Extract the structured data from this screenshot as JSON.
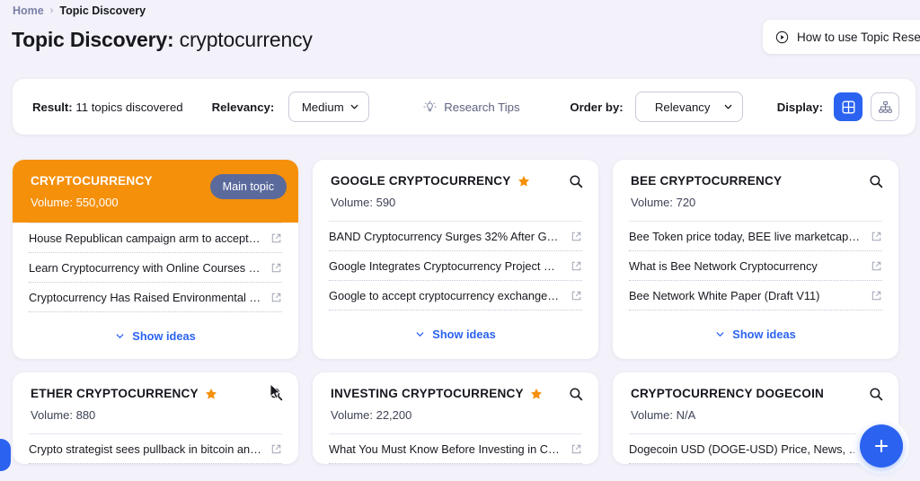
{
  "breadcrumb": {
    "home": "Home",
    "separator": "›",
    "current": "Topic Discovery"
  },
  "header": {
    "title_strong": "Topic Discovery:",
    "title_term": "cryptocurrency",
    "howto_label": "How to use Topic Research",
    "howto_icon": "play-circle-icon"
  },
  "toolbar": {
    "result_label": "Result:",
    "result_value": "11 topics discovered",
    "relevancy_label": "Relevancy:",
    "relevancy_value": "Medium",
    "relevancy_options": [
      "Medium"
    ],
    "tips_label": "Research Tips",
    "tips_icon": "lightbulb-icon",
    "orderby_label": "Order by:",
    "orderby_value": "Relevancy",
    "orderby_options": [
      "Relevancy"
    ],
    "display_label": "Display:",
    "display_cards_icon": "grid-cards-icon",
    "display_mindmap_icon": "mindmap-hierarchy-icon",
    "display_active": "cards"
  },
  "colors": {
    "accent_blue": "#2b63f0",
    "main_topic_orange": "#f5900b",
    "main_topic_pill": "#5a6a9c",
    "star_orange": "#f5900b",
    "page_background": "#f3f2fa",
    "card_background": "#ffffff"
  },
  "labels": {
    "show_ideas": "Show ideas",
    "volume_prefix": "Volume:"
  },
  "cards": [
    {
      "title": "CRYPTOCURRENCY",
      "volume": "Volume: 550,000",
      "is_main": true,
      "starred": false,
      "badge": "Main topic",
      "ideas": [
        "House Republican campaign arm to accept c...",
        "Learn Cryptocurrency with Online Courses an...",
        "Cryptocurrency Has Raised Environmental C..."
      ]
    },
    {
      "title": "GOOGLE CRYPTOCURRENCY",
      "volume": "Volume: 590",
      "is_main": false,
      "starred": true,
      "ideas": [
        "BAND Cryptocurrency Surges 32% After Goo...",
        "Google Integrates Cryptocurrency Project Wi...",
        "Google to accept cryptocurrency exchange, ..."
      ]
    },
    {
      "title": "BEE CRYPTOCURRENCY",
      "volume": "Volume: 720",
      "is_main": false,
      "starred": false,
      "ideas": [
        "Bee Token price today, BEE live marketcap, c...",
        "What is Bee Network Cryptocurrency",
        "Bee Network White Paper (Draft V11)"
      ]
    },
    {
      "title": "ETHER CRYPTOCURRENCY",
      "volume": "Volume: 880",
      "is_main": false,
      "starred": true,
      "ideas": [
        "Crypto strategist sees pullback in bitcoin and..."
      ]
    },
    {
      "title": "INVESTING CRYPTOCURRENCY",
      "volume": "Volume: 22,200",
      "is_main": false,
      "starred": true,
      "ideas": [
        "What You Must Know Before Investing in Cry..."
      ]
    },
    {
      "title": "CRYPTOCURRENCY DOGECOIN",
      "volume": "Volume: N/A",
      "is_main": false,
      "starred": false,
      "ideas": [
        "Dogecoin USD (DOGE-USD) Price, News, Qu..."
      ]
    }
  ],
  "floating": {
    "add_icon": "plus-icon",
    "side_tab_icon": "side-tab-handle"
  }
}
